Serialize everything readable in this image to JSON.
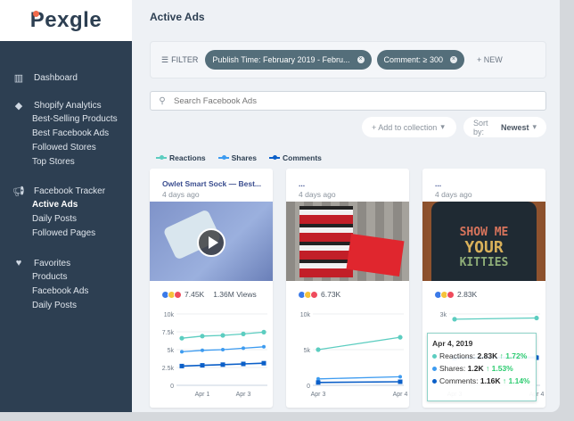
{
  "brand": {
    "name": "Pexgle",
    "accent": "#f26a4b"
  },
  "sidebar": {
    "dashboard": "Dashboard",
    "shopify": {
      "label": "Shopify Analytics",
      "items": [
        "Best-Selling Products",
        "Best Facebook Ads",
        "Followed Stores",
        "Top Stores"
      ]
    },
    "facebook": {
      "label": "Facebook Tracker",
      "items": [
        "Active Ads",
        "Daily Posts",
        "Followed Pages"
      ],
      "active": "Active Ads"
    },
    "favorites": {
      "label": "Favorites",
      "items": [
        "Products",
        "Facebook Ads",
        "Daily Posts"
      ]
    }
  },
  "page": {
    "title": "Active Ads"
  },
  "filter": {
    "label": "FILTER",
    "chips": [
      "Publish Time: February 2019 - Febru...",
      "Comment: ≥ 300"
    ],
    "new": "+ NEW"
  },
  "search": {
    "placeholder": "Search Facebook Ads",
    "value": ""
  },
  "toolbar": {
    "add_collection": "+ Add to collection",
    "sort_label": "Sort by:",
    "sort_value": "Newest"
  },
  "legend": [
    {
      "name": "Reactions",
      "color": "#5ccdc0"
    },
    {
      "name": "Shares",
      "color": "#3d9bf0"
    },
    {
      "name": "Comments",
      "color": "#0b5fc8"
    }
  ],
  "cards": [
    {
      "title": "Owlet Smart Sock — Best...",
      "date": "4 days ago",
      "reactions": "7.45K",
      "views": "1.36M Views",
      "has_video": true
    },
    {
      "title": "...",
      "date": "4 days ago",
      "reactions": "6.73K"
    },
    {
      "title": "...",
      "date": "4 days ago",
      "reactions": "2.83K",
      "image_text": [
        "SHOW ME",
        "YOUR",
        "KITTIES"
      ],
      "tooltip": {
        "date": "Apr 4, 2019",
        "rows": [
          {
            "label": "Reactions:",
            "value": "2.83K",
            "change": "↑ 1.72%"
          },
          {
            "label": "Shares:",
            "value": "1.2K",
            "change": "↑ 1.53%"
          },
          {
            "label": "Comments:",
            "value": "1.16K",
            "change": "↑ 1.14%"
          }
        ]
      }
    }
  ],
  "chart_data": [
    {
      "type": "line",
      "yticks": [
        "0",
        "2.5k",
        "5k",
        "7.5k",
        "10k"
      ],
      "ylim": [
        0,
        10000
      ],
      "xlabels": [
        {
          "i": 1,
          "t": "Apr 1"
        },
        {
          "i": 3,
          "t": "Apr 3"
        }
      ],
      "n": 5,
      "series": [
        {
          "name": "Reactions",
          "values": [
            6600,
            6900,
            7000,
            7200,
            7450
          ]
        },
        {
          "name": "Shares",
          "values": [
            4700,
            4900,
            5000,
            5200,
            5400
          ]
        },
        {
          "name": "Comments",
          "values": [
            2700,
            2800,
            2900,
            3000,
            3100
          ]
        }
      ]
    },
    {
      "type": "line",
      "yticks": [
        "0",
        "5k",
        "10k"
      ],
      "ylim": [
        0,
        10000
      ],
      "xlabels": [
        {
          "i": 0,
          "t": "Apr 3"
        },
        {
          "i": 1,
          "t": "Apr 4"
        }
      ],
      "n": 2,
      "series": [
        {
          "name": "Reactions",
          "values": [
            5000,
            6730
          ]
        },
        {
          "name": "Shares",
          "values": [
            900,
            1200
          ]
        },
        {
          "name": "Comments",
          "values": [
            400,
            500
          ]
        }
      ]
    },
    {
      "type": "line",
      "yticks": [
        "3k"
      ],
      "ylim": [
        0,
        3000
      ],
      "xlabels": [
        {
          "i": 0,
          "t": "Apr 3"
        },
        {
          "i": 1,
          "t": "Apr 4"
        }
      ],
      "n": 2,
      "series": [
        {
          "name": "Reactions",
          "values": [
            2780,
            2830
          ]
        },
        {
          "name": "Shares",
          "values": [
            1180,
            1200
          ]
        },
        {
          "name": "Comments",
          "values": [
            1150,
            1160
          ]
        }
      ]
    }
  ]
}
